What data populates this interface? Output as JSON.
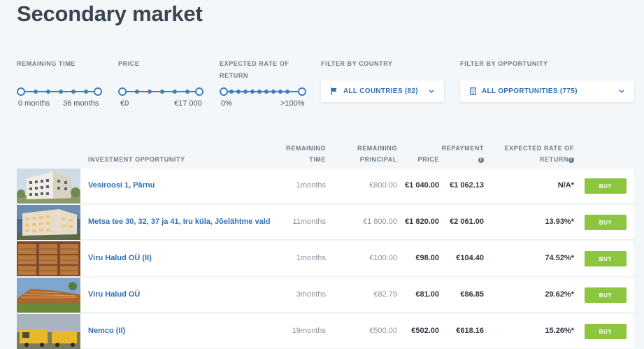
{
  "page": {
    "title": "Secondary market"
  },
  "filters": {
    "remaining_time": {
      "label": "REMAINING TIME",
      "min": "0 months",
      "max": "36 months"
    },
    "price": {
      "label": "PRICE",
      "min": "€0",
      "max": "€17 000"
    },
    "rate": {
      "label_line1": "EXPECTED RATE OF",
      "label_line2": "RETURN",
      "min": "0%",
      "max": ">100%"
    },
    "country": {
      "label": "FILTER BY COUNTRY",
      "value": "ALL COUNTRIES (82)",
      "icon": "flag-icon"
    },
    "opportunity": {
      "label": "FILTER BY OPPORTUNITY",
      "value": "ALL OPPORTUNITIES (775)",
      "icon": "building-icon"
    }
  },
  "table": {
    "headers": {
      "opportunity": "INVESTMENT OPPORTUNITY",
      "remaining_time_1": "REMAINING",
      "remaining_time_2": "TIME",
      "remaining_principal_1": "REMAINING",
      "remaining_principal_2": "PRINCIPAL",
      "price": "PRICE",
      "repayment": "REPAYMENT",
      "rate_1": "EXPECTED RATE OF",
      "rate_2": "RETURN"
    },
    "rows": [
      {
        "name": "Vesiroosi 1, Pärnu",
        "remaining_time": "1months",
        "remaining_principal": "€800.00",
        "price": "€1 040.00",
        "repayment": "€1 062.13",
        "rate": "N/A*",
        "buy": "BUY"
      },
      {
        "name": "Metsa tee 30, 32, 37 ja 41, Iru küla, Jõelähtme vald",
        "remaining_time": "11months",
        "remaining_principal": "€1 800.00",
        "price": "€1 820.00",
        "repayment": "€2 061.00",
        "rate": "13.93%*",
        "buy": "BUY"
      },
      {
        "name": "Viru Halud OÜ (II)",
        "remaining_time": "1months",
        "remaining_principal": "€100.00",
        "price": "€98.00",
        "repayment": "€104.40",
        "rate": "74.52%*",
        "buy": "BUY"
      },
      {
        "name": "Viru Halud OÜ",
        "remaining_time": "3months",
        "remaining_principal": "€82.79",
        "price": "€81.00",
        "repayment": "€86.85",
        "rate": "29.62%*",
        "buy": "BUY"
      },
      {
        "name": "Nemco (II)",
        "remaining_time": "19months",
        "remaining_principal": "€500.00",
        "price": "€502.00",
        "repayment": "€618.16",
        "rate": "15.26%*",
        "buy": "BUY"
      }
    ]
  },
  "colors": {
    "accent": "#3f7fbf",
    "link": "#2f6fb3",
    "buy": "#8cc63f",
    "background": "#f4f7f9"
  }
}
